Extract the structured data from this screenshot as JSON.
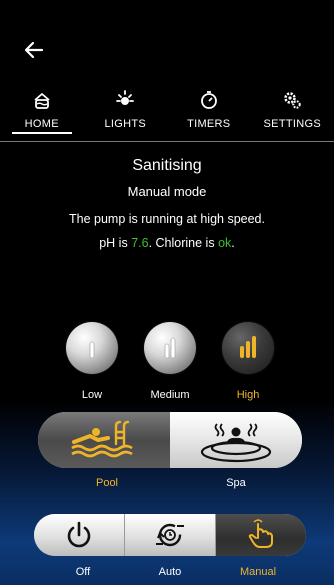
{
  "nav": {
    "tabs": [
      {
        "label": "HOME",
        "icon": "pool-home-icon",
        "active": true
      },
      {
        "label": "LIGHTS",
        "icon": "light-icon",
        "active": false
      },
      {
        "label": "TIMERS",
        "icon": "timer-icon",
        "active": false
      },
      {
        "label": "SETTINGS",
        "icon": "gear-icon",
        "active": false
      }
    ]
  },
  "status": {
    "title": "Sanitising",
    "mode": "Manual mode",
    "pump": "The pump is running at high speed.",
    "ph_prefix": "pH is ",
    "ph_value": "7.6",
    "chlorine_prefix": ". Chlorine is ",
    "chlorine_value": "ok",
    "suffix": "."
  },
  "speed": {
    "options": [
      {
        "label": "Low",
        "active": false
      },
      {
        "label": "Medium",
        "active": false
      },
      {
        "label": "High",
        "active": true
      }
    ]
  },
  "water_mode": {
    "options": [
      {
        "label": "Pool",
        "icon": "swimmer-icon",
        "active": true
      },
      {
        "label": "Spa",
        "icon": "spa-icon",
        "active": false
      }
    ]
  },
  "control": {
    "options": [
      {
        "label": "Off",
        "icon": "power-icon",
        "active": false
      },
      {
        "label": "Auto",
        "icon": "auto-cycle-icon",
        "active": false
      },
      {
        "label": "Manual",
        "icon": "hand-pointer-icon",
        "active": true
      }
    ]
  },
  "colors": {
    "accent": "#f0b429",
    "ok_green": "#3dbf33"
  }
}
